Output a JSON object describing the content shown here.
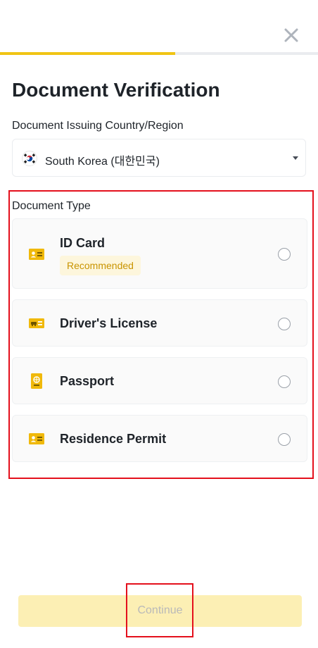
{
  "header": {
    "close_icon": "close-icon",
    "progress_fraction": 0.55,
    "progress_color": "#f0c414"
  },
  "title": "Document Verification",
  "country": {
    "label": "Document Issuing Country/Region",
    "value": "South Korea (대한민국)",
    "flag_icon": "south-korea-flag-icon",
    "dropdown_icon": "caret-down-icon"
  },
  "document_type": {
    "label": "Document Type",
    "options": [
      {
        "name": "ID Card",
        "icon": "id-card-icon",
        "badge": "Recommended",
        "selected": false
      },
      {
        "name": "Driver's License",
        "icon": "driver-license-icon",
        "selected": false
      },
      {
        "name": "Passport",
        "icon": "passport-icon",
        "selected": false
      },
      {
        "name": "Residence Permit",
        "icon": "residence-permit-icon",
        "selected": false
      }
    ]
  },
  "footer": {
    "continue_label": "Continue",
    "continue_enabled": false
  },
  "colors": {
    "accent": "#f0c414",
    "highlight_border": "#e4101c",
    "badge_bg": "#fdf6dc",
    "badge_text": "#c99400"
  }
}
